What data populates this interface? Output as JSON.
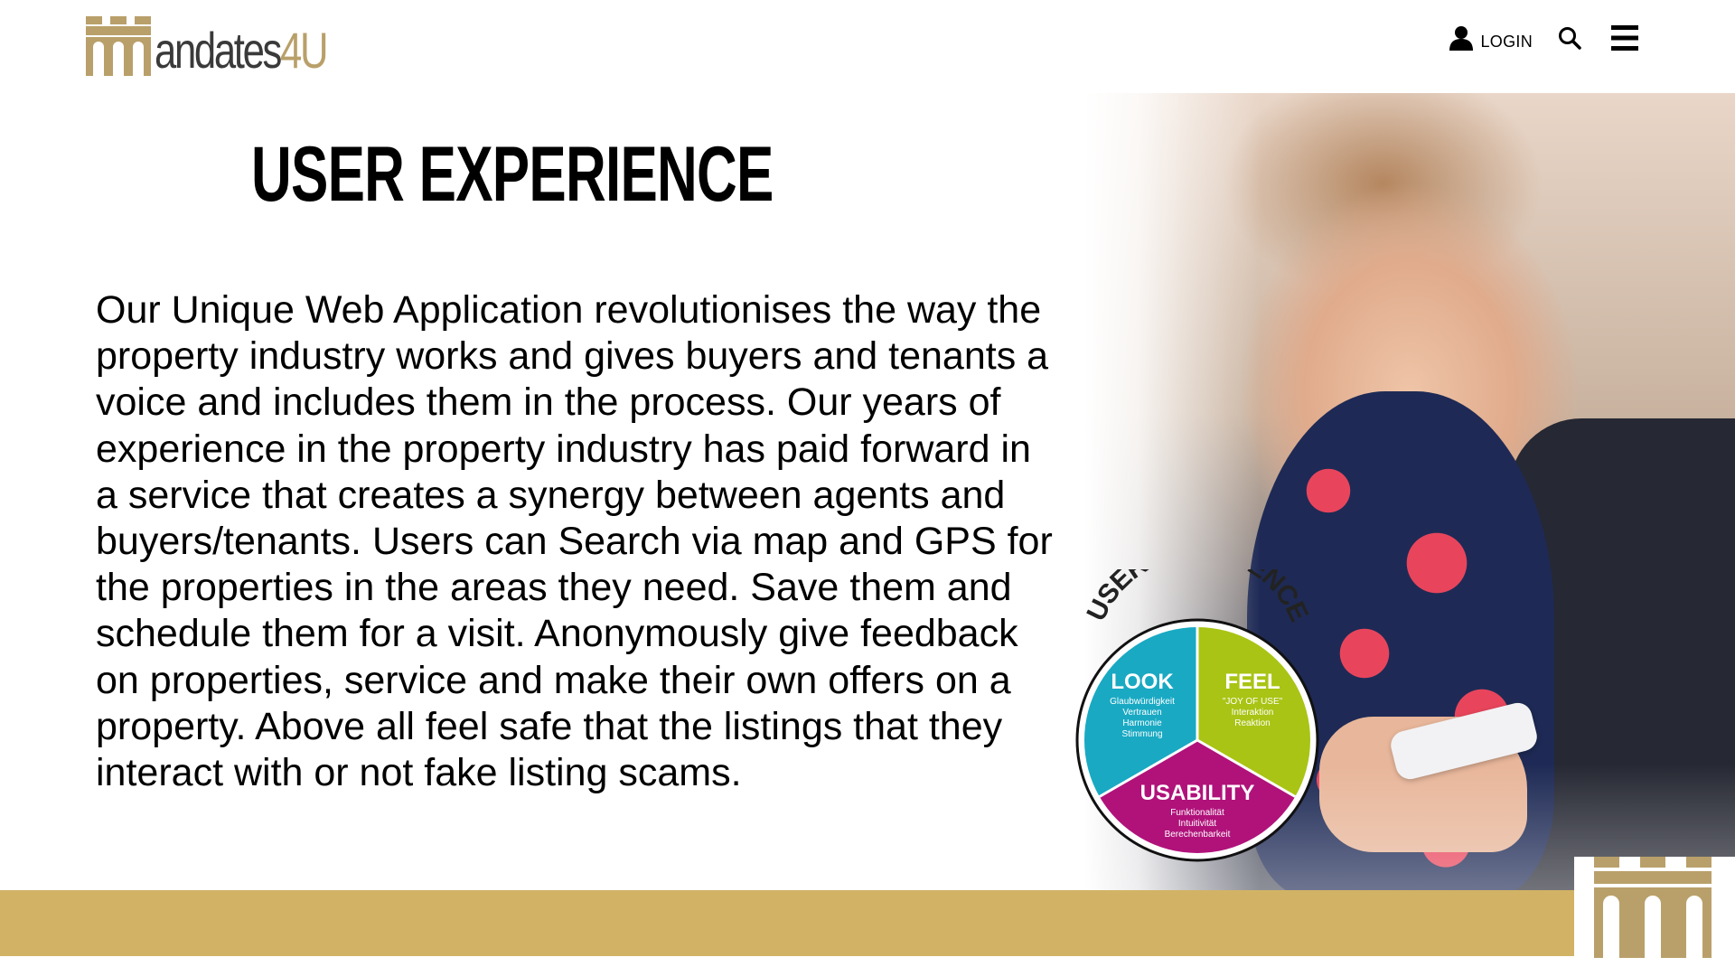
{
  "brand": {
    "name_part1": "andates",
    "name_part2": "4U",
    "gold": "#b9a06a",
    "footer_gold": "#d2b366",
    "logo_icon": "castle-icon"
  },
  "nav": {
    "login_label": "LOGIN",
    "login_icon": "user-icon",
    "search_icon": "search-icon",
    "menu_icon": "hamburger-menu-icon"
  },
  "main": {
    "title": "USER EXPERIENCE",
    "paragraph": "Our Unique Web Application revolutionises the way the property industry works and gives buyers and tenants a voice and includes them in the process. Our years of experience in the property industry has paid forward in a service that creates a synergy between agents and buyers/tenants. Users can Search via map and GPS for the properties in the areas they need. Save them and schedule them for a visit. Anonymously give feedback on properties, service and make their own offers on a property. Above all feel safe that the listings that they interact with or not fake listing scams."
  },
  "badge": {
    "arc_title": "USER EXPERIENCE",
    "segments": [
      {
        "title": "LOOK",
        "color": "#19a9c3",
        "lines": [
          "Glaubwürdigkeit",
          "Vertrauen",
          "Harmonie",
          "Stimmung"
        ]
      },
      {
        "title": "FEEL",
        "color": "#a9c414",
        "lines": [
          "\"JOY OF USE\"",
          "Interaktion",
          "Reaktion"
        ]
      },
      {
        "title": "USABILITY",
        "color": "#b0127a",
        "lines": [
          "Funktionalität",
          "Intuitivität",
          "Berechenbarkeit"
        ]
      }
    ]
  }
}
